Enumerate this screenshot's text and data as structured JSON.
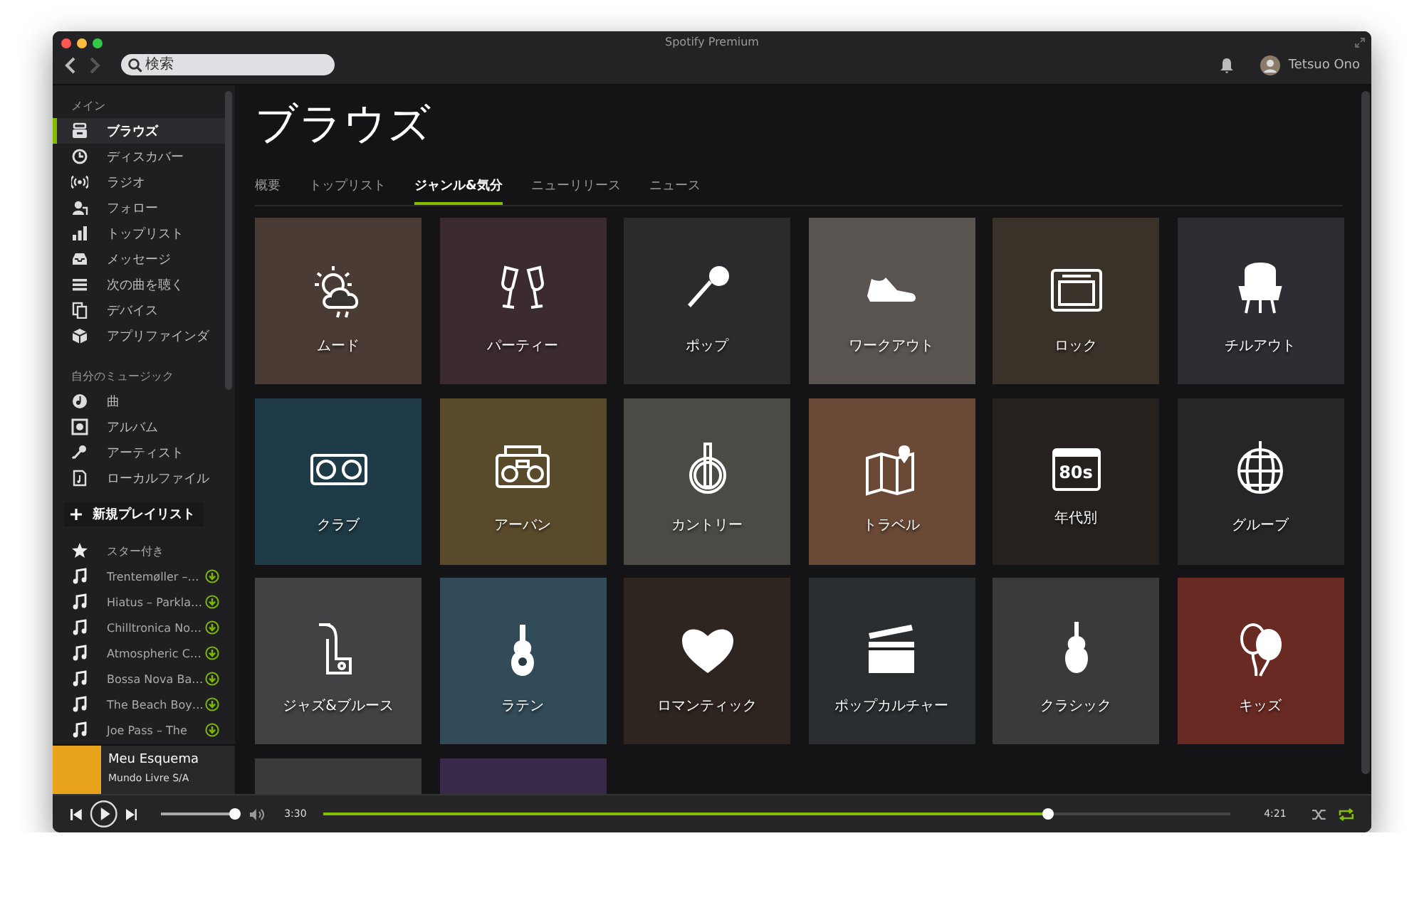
{
  "window": {
    "title": "Spotify Premium"
  },
  "toolbar": {
    "back_disabled": false,
    "forward_disabled": true,
    "search": {
      "placeholder": "検索"
    },
    "user": {
      "name": "Tetsuo Ono"
    }
  },
  "sidebar": {
    "sections": [
      {
        "heading": "メイン",
        "items": [
          {
            "label": "ブラウズ",
            "selected": true
          },
          {
            "label": "ディスカバー",
            "selected": false
          },
          {
            "label": "ラジオ",
            "selected": false
          },
          {
            "label": "フォロー",
            "selected": false
          },
          {
            "label": "トップリスト",
            "selected": false
          },
          {
            "label": "メッセージ",
            "selected": false
          },
          {
            "label": "次の曲を聴く",
            "selected": false
          },
          {
            "label": "デバイス",
            "selected": false
          },
          {
            "label": "アプリファインダ",
            "selected": false
          }
        ]
      },
      {
        "heading": "自分のミュージック",
        "items": [
          {
            "label": "曲",
            "selected": false
          },
          {
            "label": "アルバム",
            "selected": false
          },
          {
            "label": "アーティスト",
            "selected": false
          },
          {
            "label": "ローカルファイル",
            "selected": false
          }
        ]
      }
    ],
    "new_playlist": "新規プレイリスト",
    "playlists": [
      {
        "kind": "starred",
        "label": "スター付き",
        "downloaded": false
      },
      {
        "kind": "playlist",
        "label": "Trentemøller –…",
        "downloaded": true
      },
      {
        "kind": "playlist",
        "label": "Hiatus – Parkla…",
        "downloaded": true
      },
      {
        "kind": "playlist",
        "label": "Chilltronica No…",
        "downloaded": true
      },
      {
        "kind": "playlist",
        "label": "Atmospheric C…",
        "downloaded": true
      },
      {
        "kind": "playlist",
        "label": "Bossa Nova Ba…",
        "downloaded": true
      },
      {
        "kind": "playlist",
        "label": "The Beach Boy…",
        "downloaded": true
      },
      {
        "kind": "playlist",
        "label": "Joe Pass – The",
        "downloaded": true
      }
    ],
    "now_playing": {
      "title": "Meu Esquema",
      "artist": "Mundo Livre S/A"
    }
  },
  "page": {
    "title": "ブラウズ",
    "tabs": [
      {
        "label": "概要",
        "selected": false
      },
      {
        "label": "トップリスト",
        "selected": false
      },
      {
        "label": "ジャンル&気分",
        "selected": true
      },
      {
        "label": "ニューリリース",
        "selected": false
      },
      {
        "label": "ニュース",
        "selected": false
      }
    ],
    "tiles": [
      {
        "kind": "genre",
        "label": "ムード"
      },
      {
        "kind": "genre",
        "label": "パーティー"
      },
      {
        "kind": "genre",
        "label": "ポップ"
      },
      {
        "kind": "genre",
        "label": "ワークアウト"
      },
      {
        "kind": "genre",
        "label": "ロック"
      },
      {
        "kind": "genre",
        "label": "チルアウト"
      },
      {
        "kind": "genre",
        "label": "クラブ"
      },
      {
        "kind": "genre",
        "label": "アーバン"
      },
      {
        "kind": "genre",
        "label": "カントリー"
      },
      {
        "kind": "genre",
        "label": "トラベル"
      },
      {
        "kind": "genre",
        "label": "年代別",
        "icon_text": "80s"
      },
      {
        "kind": "genre",
        "label": "グルーブ"
      },
      {
        "kind": "genre",
        "label": "ジャズ&ブルース"
      },
      {
        "kind": "genre",
        "label": "ラテン"
      },
      {
        "kind": "genre",
        "label": "ロマンティック"
      },
      {
        "kind": "genre",
        "label": "ポップカルチャー"
      },
      {
        "kind": "genre",
        "label": "クラシック"
      },
      {
        "kind": "genre",
        "label": "キッズ"
      },
      {
        "kind": "photo"
      },
      {
        "kind": "photo"
      }
    ]
  },
  "player": {
    "playing": false,
    "volume": {
      "level": 0.97
    },
    "elapsed": "3:30",
    "progress": {
      "level": 0.8
    },
    "duration": "4:21",
    "shuffle": false,
    "repeat": true
  }
}
